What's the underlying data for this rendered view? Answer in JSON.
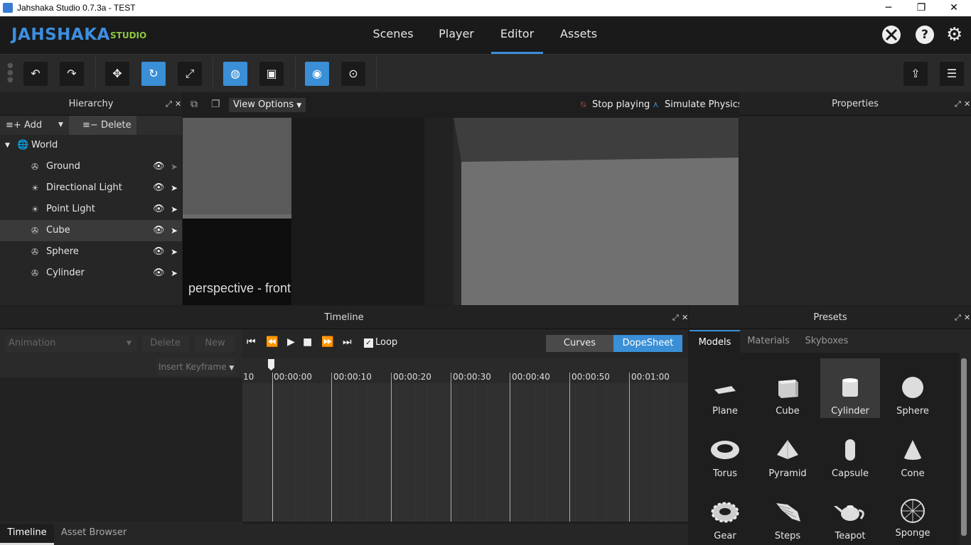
{
  "window": {
    "title": "Jahshaka Studio 0.7.3a - TEST",
    "min": "─",
    "max": "❐",
    "close": "✕"
  },
  "logo": {
    "main": "JAHSHAKA",
    "sub": "STUDIO"
  },
  "nav": {
    "tabs": [
      "Scenes",
      "Player",
      "Editor",
      "Assets"
    ],
    "active": "Editor"
  },
  "menu_icons": [
    "xbox-icon",
    "help-icon",
    "gear-icon"
  ],
  "toolbar": {
    "buttons": [
      "undo",
      "redo",
      "translate",
      "rotate",
      "scale",
      "global-space",
      "local-space",
      "visibility",
      "pivot"
    ],
    "active": [
      "rotate",
      "global-space",
      "visibility"
    ]
  },
  "hierarchy": {
    "title": "Hierarchy",
    "add_label": "Add",
    "delete_label": "Delete",
    "root": "World",
    "items": [
      {
        "label": "Ground",
        "icon": "mesh",
        "selected": false
      },
      {
        "label": "Directional Light",
        "icon": "light",
        "selected": false
      },
      {
        "label": "Point Light",
        "icon": "light",
        "selected": false
      },
      {
        "label": "Cube",
        "icon": "mesh",
        "selected": true
      },
      {
        "label": "Sphere",
        "icon": "mesh",
        "selected": false
      },
      {
        "label": "Cylinder",
        "icon": "mesh",
        "selected": false
      }
    ]
  },
  "viewport": {
    "view_options": "View Options",
    "stop_playing": "Stop playing",
    "simulate_physics": "Simulate Physics",
    "camera_label": "perspective - front"
  },
  "properties": {
    "title": "Properties"
  },
  "timeline": {
    "title": "Timeline",
    "animation_placeholder": "Animation",
    "delete_label": "Delete",
    "new_label": "New",
    "insert_keyframe": "Insert Keyframe",
    "loop_label": "Loop",
    "loop_checked": true,
    "mode_curves": "Curves",
    "mode_dopesheet": "DopeSheet",
    "ruler_start": "10",
    "ticks": [
      "00:00:00",
      "00:00:10",
      "00:00:20",
      "00:00:30",
      "00:00:40",
      "00:00:50",
      "00:01:00"
    ]
  },
  "presets": {
    "title": "Presets",
    "tabs": [
      "Models",
      "Materials",
      "Skyboxes"
    ],
    "active_tab": "Models",
    "items": [
      "Plane",
      "Cube",
      "Cylinder",
      "Sphere",
      "Torus",
      "Pyramid",
      "Capsule",
      "Cone",
      "Gear",
      "Steps",
      "Teapot",
      "Sponge"
    ],
    "selected": "Cylinder"
  },
  "bottom_tabs": {
    "timeline": "Timeline",
    "asset_browser": "Asset Browser"
  },
  "colors": {
    "accent": "#3a8fd6",
    "logo_blue": "#3d8ee0",
    "logo_green": "#8dc63f"
  }
}
